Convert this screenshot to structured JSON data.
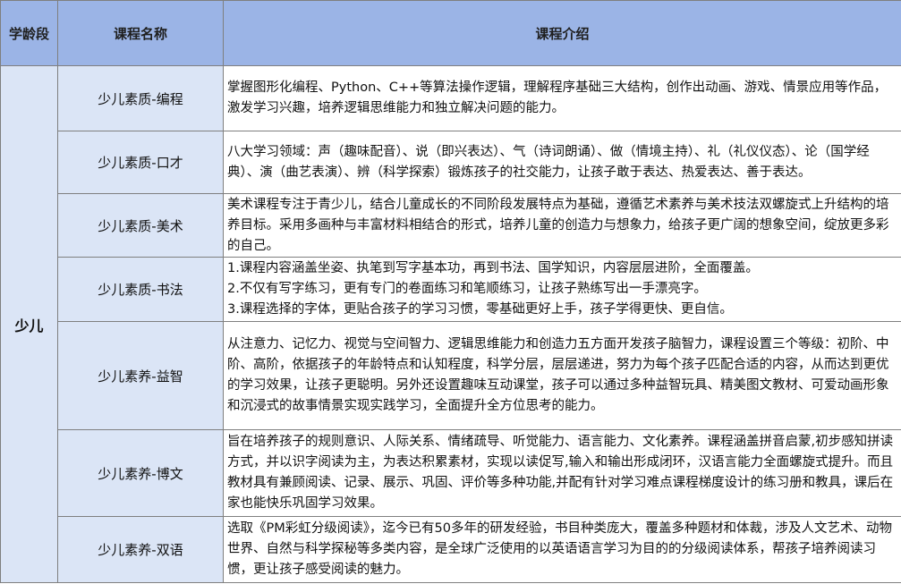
{
  "header": {
    "col_age": "学龄段",
    "col_name": "课程名称",
    "col_intro": "课程介绍"
  },
  "age_group": "少儿",
  "courses": [
    {
      "name": "少儿素质-编程",
      "lines": [
        "掌握图形化编程、Python、C++等算法操作逻辑，理解程序基础三大结构，创作出动画、游戏、情景应用等作品，激发学习兴趣，培养逻辑思维能力和独立解决问题的能力。"
      ]
    },
    {
      "name": "少儿素质-口才",
      "lines": [
        "八大学习领域：声（趣味配音）、说（即兴表达）、气（诗词朗诵）、做（情境主持）、礼（礼仪仪态）、论（国学经典）、演（曲艺表演）、辨（科学探索）锻炼孩子的社交能力，让孩子敢于表达、热爱表达、善于表达。"
      ]
    },
    {
      "name": "少儿素质-美术",
      "lines": [
        "美术课程专注于青少儿，结合儿童成长的不同阶段发展特点为基础，遵循艺术素养与美术技法双螺旋式上升结构的培养目标。采用多画种与丰富材料相结合的形式，培养儿童的创造力与想象力，给孩子更广阔的想象空间，绽放更多彩的自己。"
      ]
    },
    {
      "name": "少儿素质-书法",
      "lines": [
        "1.课程内容涵盖坐姿、执笔到写字基本功，再到书法、国学知识，内容层层进阶，全面覆盖。",
        "2.不仅有写字练习，更有专门的卷面练习和笔顺练习，让孩子熟练写出一手漂亮字。",
        "3.课程选择的字体，更贴合孩子的学习习惯，零基础更好上手，孩子学得更快、更自信。"
      ]
    },
    {
      "name": "少儿素养-益智",
      "lines": [
        "从注意力、记忆力、视觉与空间智力、逻辑思维能力和创造力五方面开发孩子脑智力，课程设置三个等级：初阶、中阶、高阶，依据孩子的年龄特点和认知程度，科学分层，层层递进，努力为每个孩子匹配合适的内容，从而达到更优的学习效果，让孩子更聪明。另外还设置趣味互动课堂，孩子可以通过多种益智玩具、精美图文教材、可爱动画形象和沉浸式的故事情景实现实践学习，全面提升全方位思考的能力。"
      ]
    },
    {
      "name": "少儿素养-博文",
      "lines": [
        "旨在培养孩子的规则意识、人际关系、情绪疏导、听觉能力、语言能力、文化素养。课程涵盖拼音启蒙,初步感知拼读方式，并以识字阅读为主，为表达积累素材，实现以读促写,输入和输出形成闭环，汉语言能力全面螺旋式提升。而且教材具有兼顾阅读、记录、展示、巩固、评价等多种功能,并配有针对学习难点课程梯度设计的练习册和教具，课后在家也能快乐巩固学习效果。"
      ]
    },
    {
      "name": "少儿素养-双语",
      "lines": [
        "选取《PM彩虹分级阅读》，迄今已有50多年的研发经验，书目种类庞大，覆盖多种题材和体裁，涉及人文艺术、动物世界、自然与科学探秘等多类内容，是全球广泛使用的以英语语言学习为目的的分级阅读体系，帮孩子培养阅读习惯，更让孩子感受阅读的魅力。"
      ]
    }
  ]
}
